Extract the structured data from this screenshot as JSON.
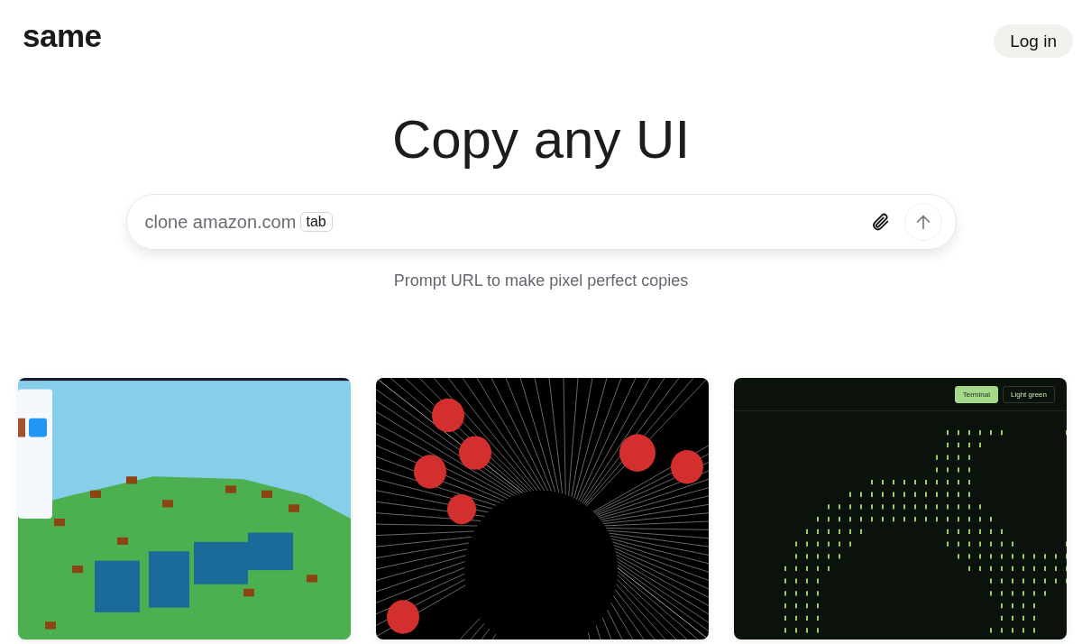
{
  "logo": "same",
  "login_button": "Log in",
  "heading": "Copy any UI",
  "prompt": {
    "placeholder": "clone amazon.com",
    "hint_key": "tab"
  },
  "subtitle": "Prompt URL to make pixel perfect copies",
  "gallery": [
    {
      "kind": "voxel"
    },
    {
      "kind": "wireframe"
    },
    {
      "kind": "terminal",
      "buttons": [
        {
          "label": "Terminal",
          "selected": true
        },
        {
          "label": "Light green",
          "selected": false
        }
      ]
    }
  ]
}
